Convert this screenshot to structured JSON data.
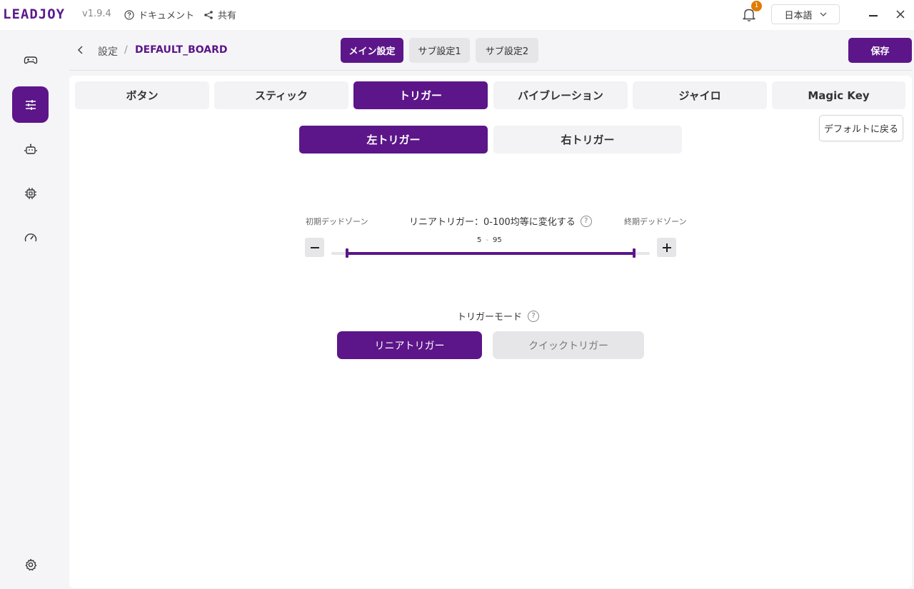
{
  "app": {
    "logo": "LEADJOY",
    "version": "v1.9.4",
    "docs_label": "ドキュメント",
    "share_label": "共有",
    "notification_count": "1",
    "language": "日本語"
  },
  "sidebar": {
    "items": [
      {
        "icon": "gamepad-icon",
        "active": false
      },
      {
        "icon": "sliders-icon",
        "active": true
      },
      {
        "icon": "robot-icon",
        "active": false
      },
      {
        "icon": "chip-icon",
        "active": false
      },
      {
        "icon": "gauge-icon",
        "active": false
      },
      {
        "icon": "gear-icon",
        "active": false
      }
    ]
  },
  "header": {
    "breadcrumb_root": "設定",
    "breadcrumb_sep": "/",
    "breadcrumb_current": "DEFAULT_BOARD",
    "segments": [
      "メイン設定",
      "サブ設定1",
      "サブ設定2"
    ],
    "active_segment": 0,
    "save_label": "保存"
  },
  "tabs": {
    "items": [
      "ボタン",
      "スティック",
      "トリガー",
      "バイブレーション",
      "ジャイロ",
      "Magic Key"
    ],
    "active": 2
  },
  "reset_label": "デフォルトに戻る",
  "subtabs": {
    "items": [
      "左トリガー",
      "右トリガー"
    ],
    "active": 0
  },
  "slider": {
    "left_label": "初期デッドゾーン",
    "title": "リニアトリガー：0-100均等に変化する",
    "help": "?",
    "right_label": "終期デッドゾーン",
    "min_value": "5",
    "range_sep": "-",
    "max_value": "95",
    "minus": "−",
    "plus": "+"
  },
  "trigger_mode": {
    "title": "トリガーモード",
    "help": "?",
    "options": [
      "リニアトリガー",
      "クイックトリガー"
    ],
    "active": 0
  },
  "colors": {
    "accent": "#5c1689",
    "badge": "#e07b00"
  }
}
